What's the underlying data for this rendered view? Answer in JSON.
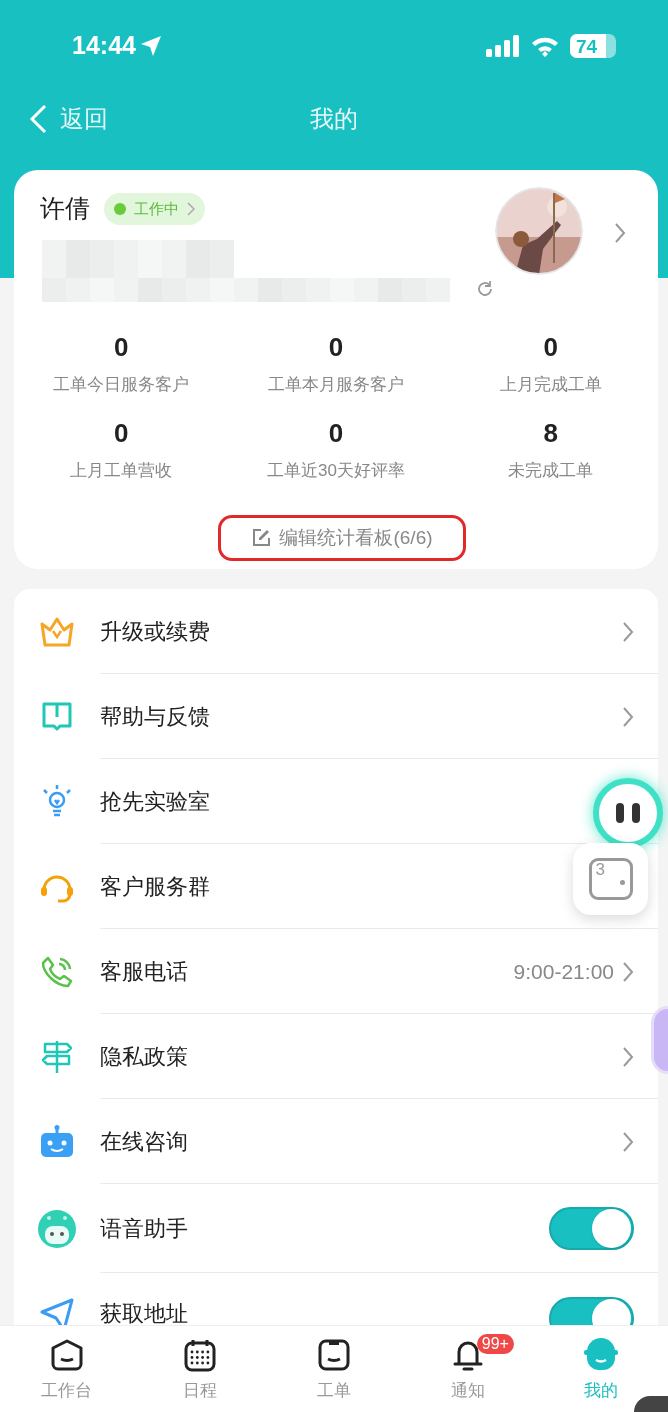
{
  "status_bar": {
    "time": "14:44",
    "battery": "74"
  },
  "nav": {
    "back": "返回",
    "title": "我的"
  },
  "profile": {
    "name": "许倩",
    "status": {
      "label": "工作中",
      "on": true
    },
    "stats": [
      {
        "value": "0",
        "label": "工单今日服务客户"
      },
      {
        "value": "0",
        "label": "工单本月服务客户"
      },
      {
        "value": "0",
        "label": "上月完成工单"
      },
      {
        "value": "0",
        "label": "上月工单营收"
      },
      {
        "value": "0",
        "label": "工单近30天好评率"
      },
      {
        "value": "8",
        "label": "未完成工单"
      }
    ],
    "edit_button": "编辑统计看板(6/6)"
  },
  "menu": [
    {
      "kind": "link",
      "label": "升级或续费"
    },
    {
      "kind": "link",
      "label": "帮助与反馈"
    },
    {
      "kind": "plain",
      "label": "抢先实验室"
    },
    {
      "kind": "plain",
      "label": "客户服务群"
    },
    {
      "kind": "link",
      "label": "客服电话",
      "value": "9:00-21:00"
    },
    {
      "kind": "link",
      "label": "隐私政策"
    },
    {
      "kind": "link",
      "label": "在线咨询"
    },
    {
      "kind": "toggle",
      "label": "语音助手",
      "on": true
    },
    {
      "kind": "toggle",
      "label": "获取地址",
      "on": true
    }
  ],
  "floating_badge": "3",
  "tabs": [
    {
      "label": "工作台",
      "selected": false
    },
    {
      "label": "日程",
      "selected": false
    },
    {
      "label": "工单",
      "selected": false
    },
    {
      "label": "通知",
      "selected": false,
      "badge": "99+"
    },
    {
      "label": "我的",
      "selected": true
    }
  ]
}
